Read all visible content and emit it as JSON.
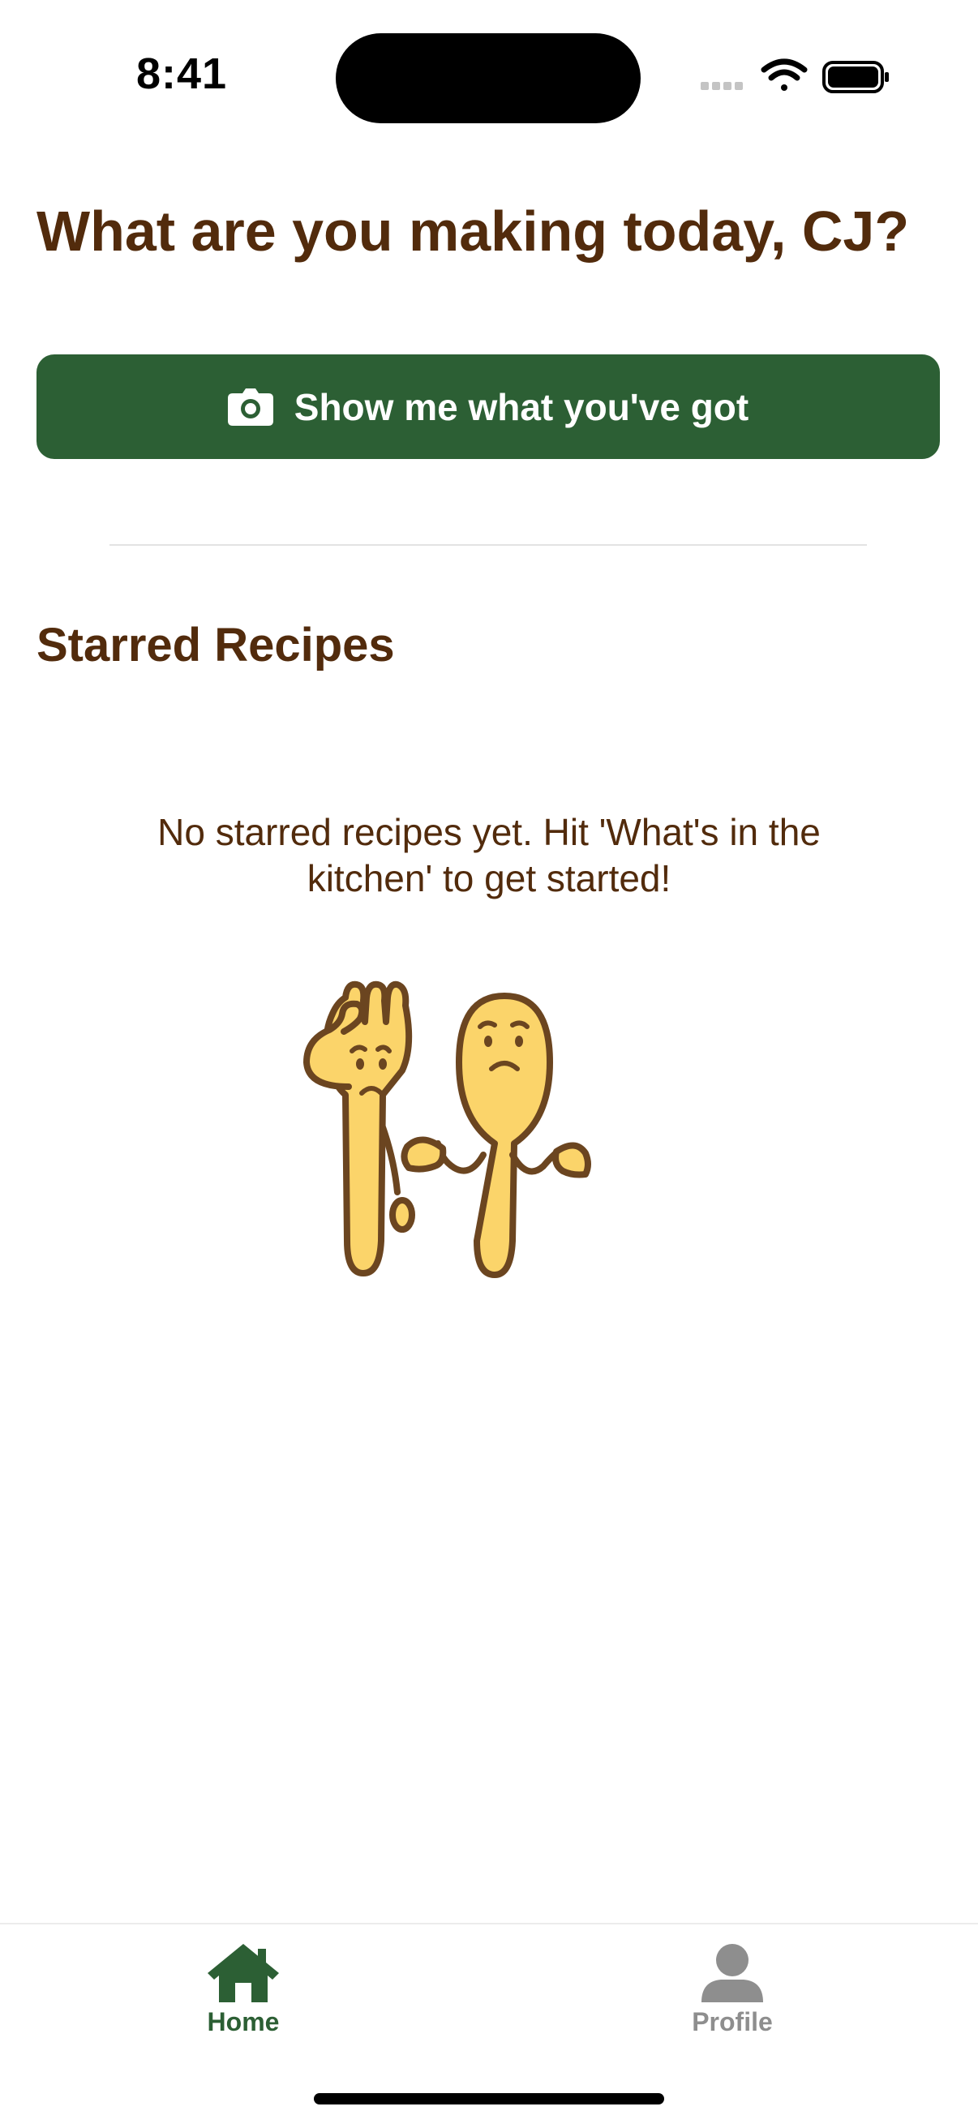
{
  "status_bar": {
    "time": "8:41"
  },
  "header": {
    "greeting": "What are you making today, CJ?"
  },
  "actions": {
    "scan_button_label": "Show me what you've got",
    "scan_button_icon": "camera-icon"
  },
  "starred": {
    "title": "Starred Recipes",
    "empty_message": "No starred recipes yet. Hit 'What's in the kitchen' to get started!",
    "illustration": "confused-fork-and-spoon"
  },
  "tab_bar": {
    "tabs": [
      {
        "label": "Home",
        "icon": "house-icon",
        "selected": true
      },
      {
        "label": "Profile",
        "icon": "person-icon",
        "selected": false
      }
    ]
  },
  "colors": {
    "brand_green": "#2c5f34",
    "heading_brown": "#522b0c",
    "illustration_yellow": "#fbd46a",
    "inactive_gray": "#8e8e8e"
  }
}
